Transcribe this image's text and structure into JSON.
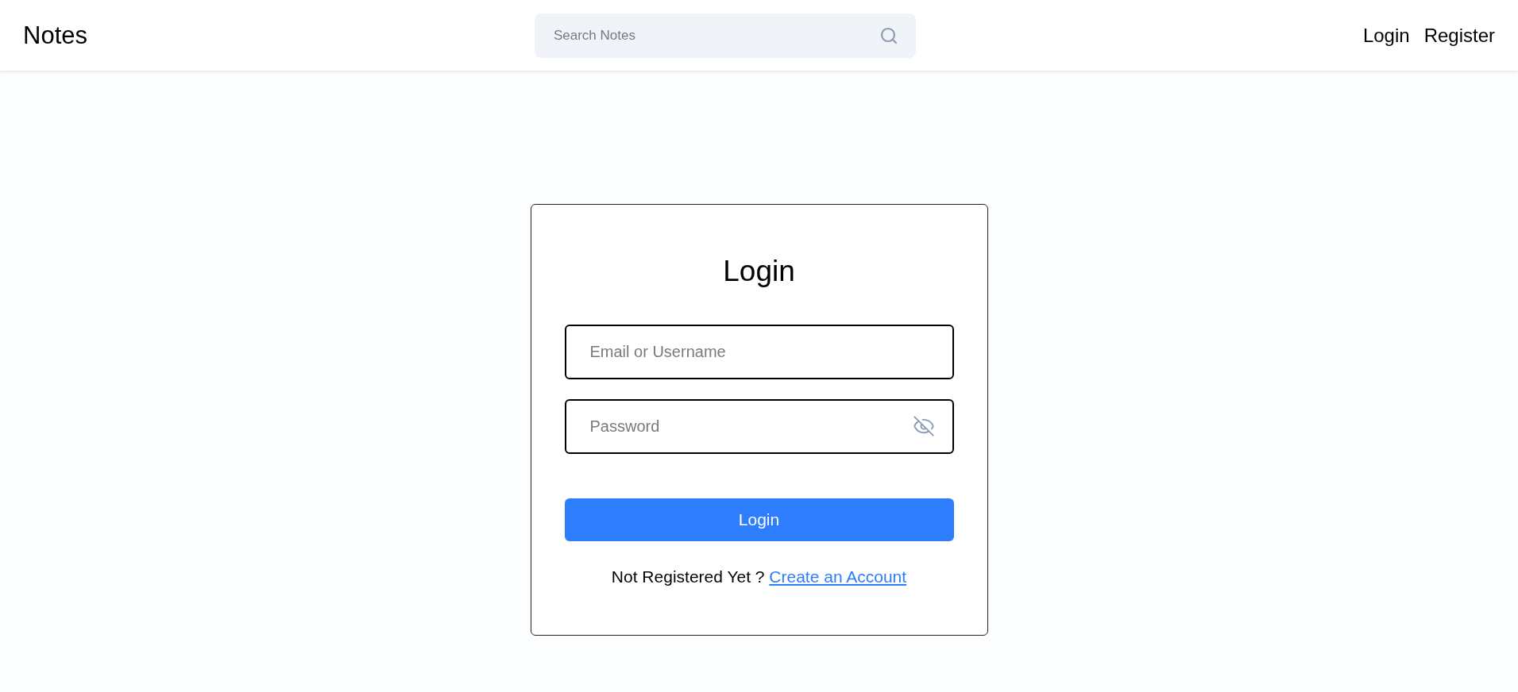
{
  "header": {
    "logo": "Notes",
    "search": {
      "placeholder": "Search Notes"
    },
    "nav_links": [
      "Login",
      "Register"
    ]
  },
  "login_card": {
    "title": "Login",
    "fields": [
      {
        "kind": "text",
        "placeholder": "Email or Username"
      },
      {
        "kind": "password",
        "placeholder": "Password"
      }
    ],
    "submit_button": "Login",
    "footer": {
      "text": "Not Registered Yet ?",
      "link": "Create an Account"
    }
  }
}
